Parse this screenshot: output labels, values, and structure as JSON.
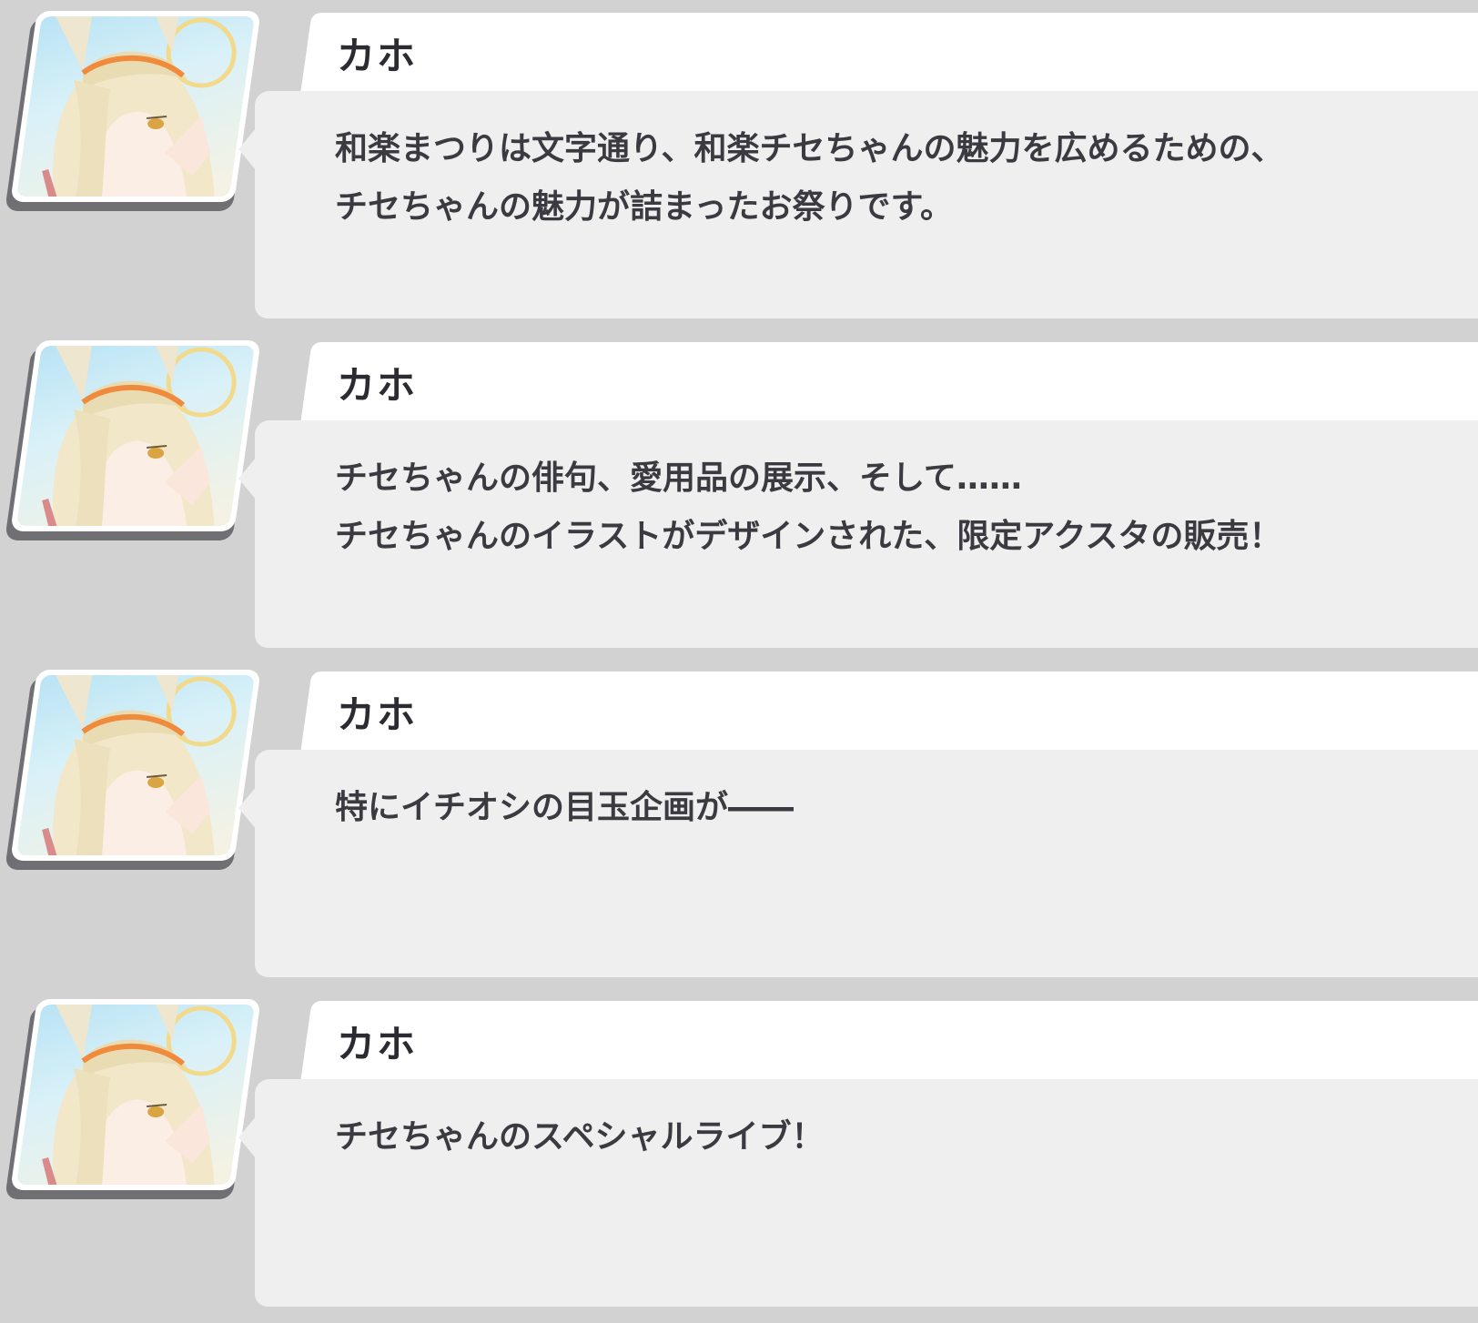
{
  "messages": [
    {
      "speaker": "カホ",
      "text": "和楽まつりは文字通り、和楽チセちゃんの魅力を広めるための、\nチセちゃんの魅力が詰まったお祭りです。"
    },
    {
      "speaker": "カホ",
      "text": "チセちゃんの俳句、愛用品の展示、そして……\nチセちゃんのイラストがデザインされた、限定アクスタの販売！"
    },
    {
      "speaker": "カホ",
      "text": "特にイチオシの目玉企画が――"
    },
    {
      "speaker": "カホ",
      "text": "チセちゃんのスペシャルライブ！"
    }
  ],
  "colors": {
    "background": "#d3d2d3",
    "bubble": "#efefef",
    "name_tab": "#ffffff",
    "text": "#3a3a40"
  },
  "icons": {
    "avatar": "portrait-kaho-avatar"
  }
}
